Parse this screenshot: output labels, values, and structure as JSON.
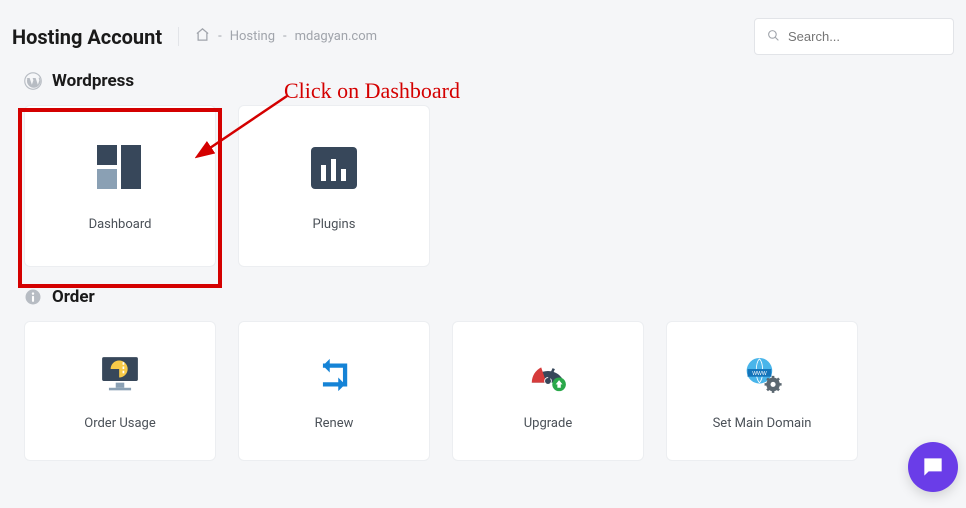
{
  "header": {
    "title": "Hosting Account",
    "breadcrumb": {
      "hosting": "Hosting",
      "domain": "mdagyan.com",
      "sep": "-"
    },
    "search_placeholder": "Search..."
  },
  "sections": {
    "wordpress": {
      "title": "Wordpress",
      "cards": {
        "dashboard": "Dashboard",
        "plugins": "Plugins"
      }
    },
    "order": {
      "title": "Order",
      "cards": {
        "order_usage": "Order Usage",
        "renew": "Renew",
        "upgrade": "Upgrade",
        "set_main_domain": "Set Main Domain"
      }
    }
  },
  "annotation": {
    "text": "Click on Dashboard"
  }
}
